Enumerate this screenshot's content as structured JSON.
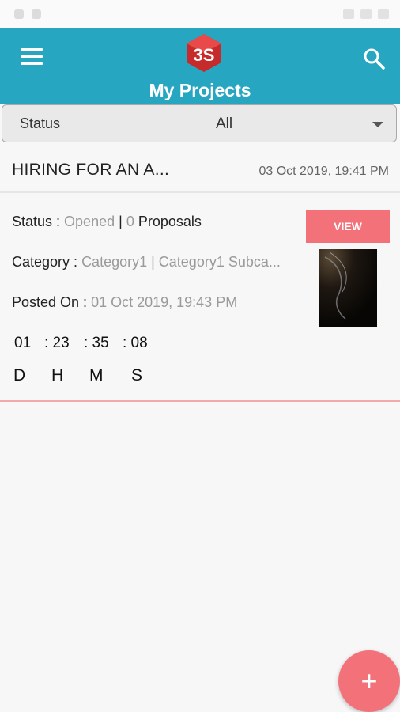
{
  "app": {
    "title": "My Projects",
    "accent_color": "#27a6c2",
    "button_color": "#f3727a",
    "icons": {
      "menu": "hamburger-menu-icon",
      "search": "search-icon",
      "logo": "3s-logo",
      "fab": "plus-icon",
      "dropdown": "caret-down-icon"
    }
  },
  "filter": {
    "label": "Status",
    "value": "All"
  },
  "project": {
    "title": "HIRING FOR AN A...",
    "date": "03 Oct 2019, 19:41 PM",
    "status_label": "Status :",
    "status_value": "Opened",
    "status_sep": "|",
    "proposals_count": "0",
    "proposals_label": "Proposals",
    "category_label": "Category :",
    "category_value": "Category1 | Category1 Subca...",
    "posted_label": "Posted On :",
    "posted_value": "01 Oct 2019, 19:43 PM",
    "view_label": "VIEW",
    "countdown": {
      "days": "01",
      "hours": ": 23",
      "minutes": ": 35",
      "seconds": ": 08",
      "labels": [
        "D",
        "H",
        "M",
        "S"
      ]
    }
  },
  "fab_label": "+"
}
